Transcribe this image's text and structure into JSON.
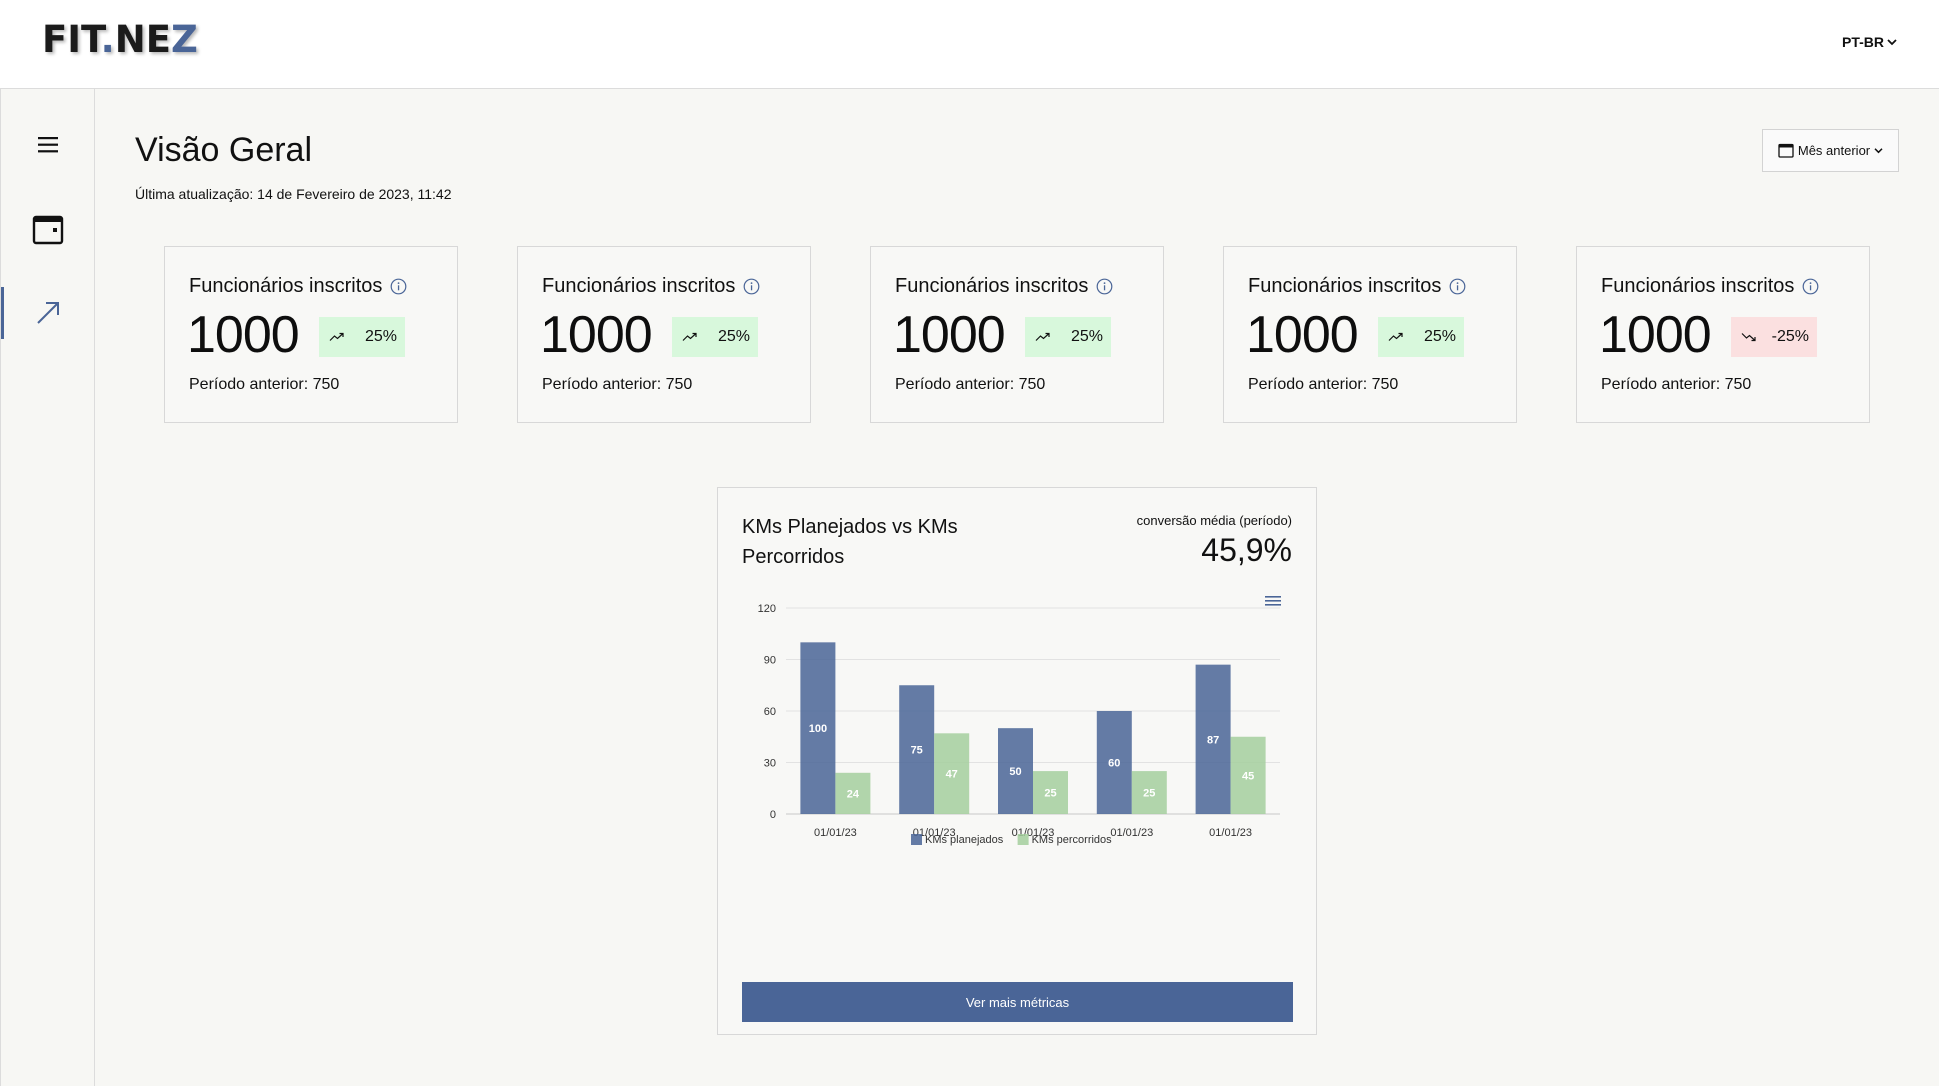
{
  "header": {
    "logo": {
      "part1": "FIT",
      "dot": ".",
      "part2": "NE",
      "part3": "Z"
    },
    "language": "PT-BR"
  },
  "sidebar": {
    "items": [
      {
        "icon": "menu-icon"
      },
      {
        "icon": "calendar-icon"
      },
      {
        "icon": "trending-arrow-icon",
        "active": true
      }
    ]
  },
  "page": {
    "title": "Visão Geral",
    "last_update": "Última atualização: 14 de Fevereiro de 2023, 11:42",
    "period_filter": "Mês anterior"
  },
  "cards": [
    {
      "label": "Funcionários inscritos",
      "value": "1000",
      "change": "25%",
      "trend": "up",
      "previous": "Período anterior: 750"
    },
    {
      "label": "Funcionários inscritos",
      "value": "1000",
      "change": "25%",
      "trend": "up",
      "previous": "Período anterior: 750"
    },
    {
      "label": "Funcionários inscritos",
      "value": "1000",
      "change": "25%",
      "trend": "up",
      "previous": "Período anterior: 750"
    },
    {
      "label": "Funcionários inscritos",
      "value": "1000",
      "change": "25%",
      "trend": "up",
      "previous": "Período anterior: 750"
    },
    {
      "label": "Funcionários inscritos",
      "value": "1000",
      "change": "-25%",
      "trend": "down",
      "previous": "Período anterior: 750"
    }
  ],
  "chart_panel": {
    "title": "KMs Planejados vs KMs Percorridos",
    "conversion_label": "conversão média (período)",
    "conversion_value": "45,9%",
    "cta": "Ver mais métricas"
  },
  "colors": {
    "accent": "#4a6597",
    "planned": "#4a6597",
    "done": "#a5cf9e",
    "badge_up": "#d8f8dc",
    "badge_down": "#fbe0e0"
  },
  "chart_data": {
    "type": "bar",
    "categories": [
      "01/01/23",
      "01/01/23",
      "01/01/23",
      "01/01/23",
      "01/01/23"
    ],
    "series": [
      {
        "name": "KMs planejados",
        "values": [
          100,
          75,
          50,
          60,
          87
        ]
      },
      {
        "name": "KMs percorridos",
        "values": [
          24,
          47,
          25,
          25,
          45
        ]
      }
    ],
    "yticks": [
      "0",
      "30",
      "60",
      "90",
      "120"
    ],
    "ylim": [
      0,
      120
    ],
    "grid": true,
    "legend": "bottom"
  }
}
